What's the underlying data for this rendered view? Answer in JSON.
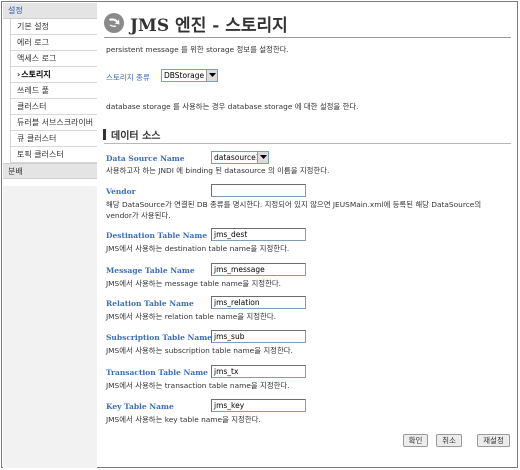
{
  "sidebar": {
    "tab_label": "설정",
    "items": [
      {
        "label": "기본 설정",
        "active": false
      },
      {
        "label": "에러 로그",
        "active": false
      },
      {
        "label": "액세스 로그",
        "active": false
      },
      {
        "label": "스토리지",
        "active": true,
        "marker": "›"
      },
      {
        "label": "쓰레드 풀",
        "active": false
      },
      {
        "label": "클러스터",
        "active": false
      },
      {
        "label": "듀러블 서브스크라이버",
        "active": false
      },
      {
        "label": "큐 클러스터",
        "active": false
      },
      {
        "label": "토픽 클러스터",
        "active": false
      }
    ],
    "bottom_label": "분배"
  },
  "header": {
    "title": "JMS 엔진 - 스토리지",
    "description": "persistent message 를 위한 storage 정보를 설정한다."
  },
  "storage_type": {
    "label": "스토리지 종류",
    "value": "DBStorage",
    "help": "database storage 를 사용하는 경우 database storage 에 대한 설정을 한다."
  },
  "section": {
    "title": "데이터 소스"
  },
  "fields": {
    "data_source_name": {
      "label": "Data Source Name",
      "value": "datasource1",
      "help": "사용하고자 하는 JNDI 에 binding 된 datasource 의 이름을 지정한다."
    },
    "vendor": {
      "label": "Vendor",
      "value": "",
      "help_line1": "해당 DataSource가 연결된 DB 종류를 명시한다. 지정되어 있지 않으면 JEUSMain.xml에 등록된 해당 DataSource의",
      "help_line2": "vendor가 사용된다."
    },
    "destination_table": {
      "label": "Destination Table Name",
      "value": "jms_dest",
      "help": "JMS에서 사용하는 destination table name을 지정한다."
    },
    "message_table": {
      "label": "Message Table Name",
      "value": "jms_message",
      "help": "JMS에서 사용하는 message table name을 지정한다."
    },
    "relation_table": {
      "label": "Relation Table Name",
      "value": "jms_relation",
      "help": "JMS에서 사용하는 relation table name을 지정한다."
    },
    "subscription_table": {
      "label": "Subscription Table Name",
      "value": "jms_sub",
      "help": "JMS에서 사용하는 subscription table name을 지정한다."
    },
    "transaction_table": {
      "label": "Transaction Table Name",
      "value": "jms_tx",
      "help": "JMS에서 사용하는 transaction table name을 지정한다."
    },
    "key_table": {
      "label": "Key Table Name",
      "value": "jms_key",
      "help": "JMS에서 사용하는 key table name을 지정한다."
    }
  },
  "buttons": {
    "confirm": "확인",
    "cancel": "취소",
    "reset": "재설정"
  },
  "icons": {
    "title": "arrow-circle-icon",
    "dropdown": "chevron-down-icon"
  },
  "colors": {
    "label_blue": "#3b6eb5",
    "sidebar_tab": "#e4e4e4"
  }
}
